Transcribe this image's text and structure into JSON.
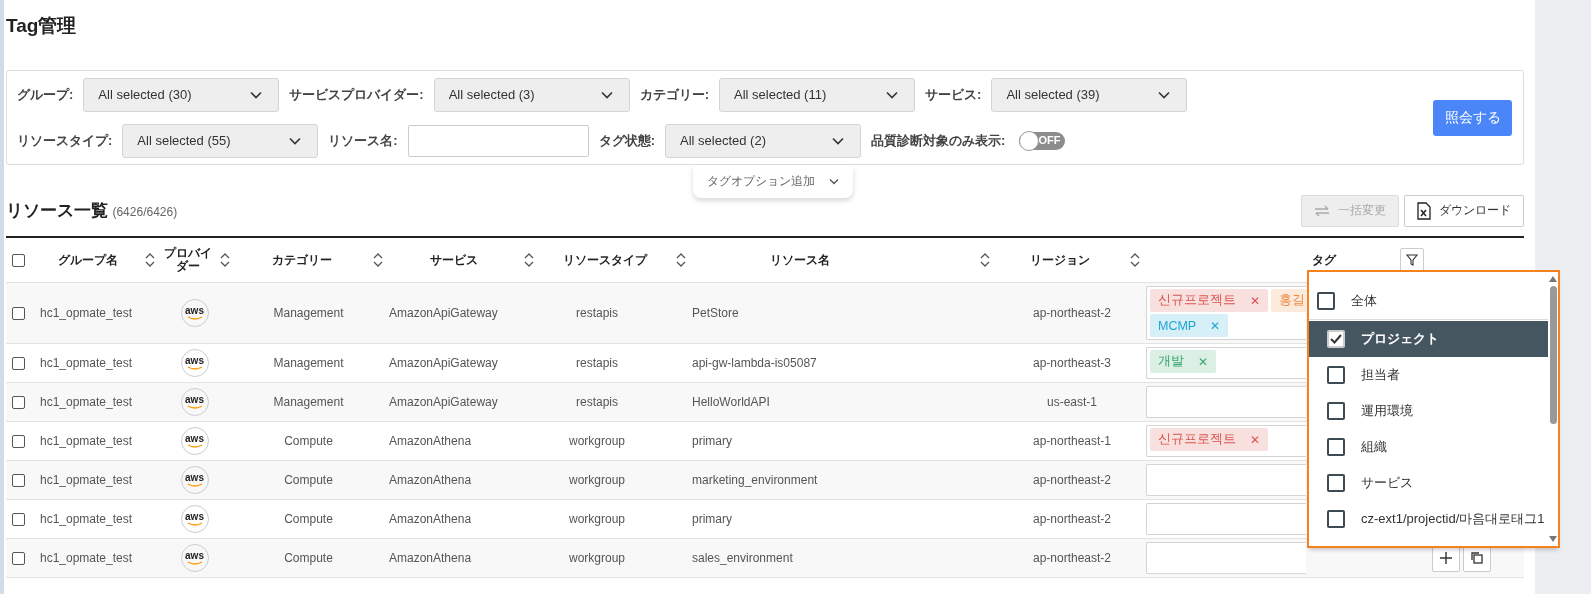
{
  "page": {
    "title": "Tag管理"
  },
  "filter_rows": [
    [
      {
        "kind": "select",
        "label": "グループ:",
        "value": "All selected (30)"
      },
      {
        "kind": "select",
        "label": "サービスプロバイダー:",
        "value": "All selected (3)"
      },
      {
        "kind": "select",
        "label": "カテゴリー:",
        "value": "All selected (11)"
      },
      {
        "kind": "select",
        "label": "サービス:",
        "value": "All selected (39)"
      }
    ],
    [
      {
        "kind": "select",
        "label": "リソースタイプ:",
        "value": "All selected (55)"
      },
      {
        "kind": "text",
        "label": "リソース名:"
      },
      {
        "kind": "select",
        "label": "タグ状態:",
        "value": "All selected (2)"
      },
      {
        "kind": "toggle",
        "label": "品質診断対象のみ表示:",
        "on": false,
        "text": "OFF"
      }
    ]
  ],
  "search_button": "照会する",
  "tag_option_tab": "タグオプション追加",
  "list": {
    "title": "リソース一覧",
    "count": "(6426/6426)",
    "bulk_button": {
      "label": "一括変更",
      "disabled": true
    },
    "download_button": "ダウンロード"
  },
  "table": {
    "select_all": {
      "checked": false
    },
    "columns": [
      {
        "label": "グループ名",
        "kind": "sort"
      },
      {
        "label": "プロバイダー",
        "kind": "sort"
      },
      {
        "label": "カテゴリー",
        "kind": "sort"
      },
      {
        "label": "サービス",
        "kind": "sort"
      },
      {
        "label": "リソースタイプ",
        "kind": "sort"
      },
      {
        "label": "リソース名",
        "kind": "sort"
      },
      {
        "label": "リージョン",
        "kind": "sort"
      },
      {
        "label": "タグ",
        "kind": "filter"
      }
    ],
    "rows": [
      {
        "checked": false,
        "group": "hc1_opmate_test",
        "provider": "aws",
        "category": "Management",
        "service": "AmazonApiGateway",
        "type": "restapis",
        "name": "PetStore",
        "region": "ap-northeast-2",
        "tags": [
          {
            "text": "신규프로젝트",
            "remove": "✕",
            "color": "#d9534f"
          },
          {
            "text": "홍길",
            "color": "#f0883e"
          },
          {
            "text": "MCMP",
            "remove": "✕",
            "color": "#1fa5d4"
          }
        ]
      },
      {
        "checked": false,
        "group": "hc1_opmate_test",
        "provider": "aws",
        "category": "Management",
        "service": "AmazonApiGateway",
        "type": "restapis",
        "name": "api-gw-lambda-is05087",
        "region": "ap-northeast-3",
        "tags": [
          {
            "text": "개발",
            "remove": "✕",
            "color": "#3aa56b"
          }
        ]
      },
      {
        "checked": false,
        "group": "hc1_opmate_test",
        "provider": "aws",
        "category": "Management",
        "service": "AmazonApiGateway",
        "type": "restapis",
        "name": "HelloWorldAPI",
        "region": "us-east-1",
        "tags": []
      },
      {
        "checked": false,
        "group": "hc1_opmate_test",
        "provider": "aws",
        "category": "Compute",
        "service": "AmazonAthena",
        "type": "workgroup",
        "name": "primary",
        "region": "ap-northeast-1",
        "tags": [
          {
            "text": "신규프로젝트",
            "remove": "✕",
            "color": "#d9534f"
          }
        ]
      },
      {
        "checked": false,
        "group": "hc1_opmate_test",
        "provider": "aws",
        "category": "Compute",
        "service": "AmazonAthena",
        "type": "workgroup",
        "name": "marketing_environment",
        "region": "ap-northeast-2",
        "tags": []
      },
      {
        "checked": false,
        "group": "hc1_opmate_test",
        "provider": "aws",
        "category": "Compute",
        "service": "AmazonAthena",
        "type": "workgroup",
        "name": "primary",
        "region": "ap-northeast-2",
        "tags": []
      },
      {
        "checked": false,
        "group": "hc1_opmate_test",
        "provider": "aws",
        "category": "Compute",
        "service": "AmazonAthena",
        "type": "workgroup",
        "name": "sales_environment",
        "region": "ap-northeast-2",
        "tags": [],
        "show_actions": true
      }
    ]
  },
  "tag_filter_menu": {
    "options": [
      {
        "label": "全体",
        "checked": false,
        "selected": false
      },
      {
        "label": "プロジェクト",
        "checked": true,
        "selected": true
      },
      {
        "label": "担当者",
        "checked": false,
        "selected": false
      },
      {
        "label": "運用環境",
        "checked": false,
        "selected": false
      },
      {
        "label": "組織",
        "checked": false,
        "selected": false
      },
      {
        "label": "サービス",
        "checked": false,
        "selected": false
      },
      {
        "label": "cz-ext1/projectid/마음대로태그1",
        "checked": false,
        "selected": false
      }
    ]
  }
}
